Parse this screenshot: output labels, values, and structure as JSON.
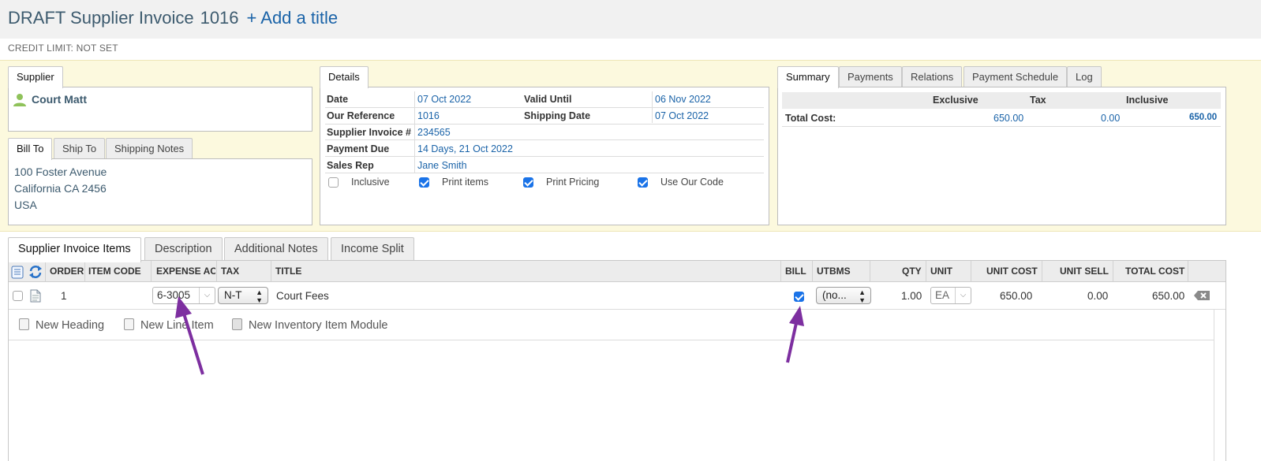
{
  "header": {
    "title": "DRAFT Supplier Invoice",
    "number": "1016",
    "add_title": "+ Add a title",
    "credit_limit": "CREDIT LIMIT: NOT SET"
  },
  "supplier": {
    "tab": "Supplier",
    "name": "Court Matt"
  },
  "address_tabs": [
    "Bill To",
    "Ship To",
    "Shipping Notes"
  ],
  "bill_to": {
    "line1": "100 Foster Avenue",
    "line2": "California CA 2456",
    "line3": "USA"
  },
  "details": {
    "tab": "Details",
    "date_label": "Date",
    "date": "07 Oct 2022",
    "valid_until_label": "Valid Until",
    "valid_until": "06 Nov 2022",
    "our_reference_label": "Our Reference",
    "our_reference": "1016",
    "shipping_date_label": "Shipping Date",
    "shipping_date": "07 Oct 2022",
    "supplier_invoice_label": "Supplier Invoice #",
    "supplier_invoice": "234565",
    "payment_due_label": "Payment Due",
    "payment_due": "14 Days, 21 Oct 2022",
    "sales_rep_label": "Sales Rep",
    "sales_rep": "Jane Smith",
    "options": {
      "inclusive": {
        "label": "Inclusive",
        "checked": false
      },
      "print_items": {
        "label": "Print items",
        "checked": true
      },
      "print_pricing": {
        "label": "Print Pricing",
        "checked": true
      },
      "use_our_code": {
        "label": "Use Our Code",
        "checked": true
      }
    }
  },
  "summary_tabs": [
    "Summary",
    "Payments",
    "Relations",
    "Payment Schedule",
    "Log"
  ],
  "summary": {
    "col_exclusive": "Exclusive",
    "col_tax": "Tax",
    "col_inclusive": "Inclusive",
    "row_label": "Total Cost:",
    "exclusive": "650.00",
    "tax": "0.00",
    "inclusive": "650.00"
  },
  "item_tabs": [
    "Supplier Invoice Items",
    "Description",
    "Additional Notes",
    "Income Split"
  ],
  "columns": {
    "order": "ORDER",
    "item_code": "ITEM CODE",
    "expense_ac": "EXPENSE AC",
    "tax": "TAX",
    "title": "TITLE",
    "bill": "BILL",
    "utbms": "UTBMS",
    "qty": "QTY",
    "unit": "UNIT",
    "unit_cost": "UNIT COST",
    "unit_sell": "UNIT SELL",
    "total_cost": "TOTAL COST"
  },
  "row": {
    "order": "1",
    "expense_ac": "6-3005",
    "tax": "N-T",
    "title": "Court Fees",
    "bill": true,
    "utbms": "(no...",
    "qty": "1.00",
    "unit": "EA",
    "unit_cost": "650.00",
    "unit_sell": "0.00",
    "total_cost": "650.00"
  },
  "actions": {
    "new_heading": "New Heading",
    "new_line_item": "New Line Item",
    "new_inventory_item_module": "New Inventory Item Module"
  },
  "colors": {
    "link": "#1a63a8",
    "title": "#3c5a6e",
    "highlight_band": "#fcf9de",
    "annotation_arrow": "#7d2fa0",
    "checkbox_on": "#1a73e8"
  }
}
